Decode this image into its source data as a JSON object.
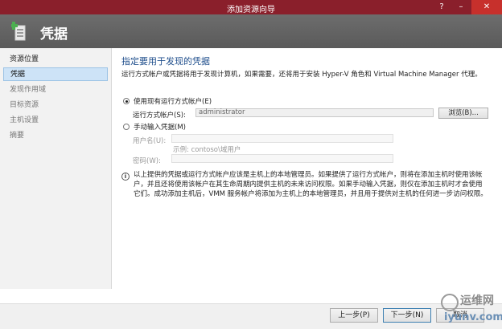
{
  "window": {
    "title": "添加资源向导",
    "help_label": "?",
    "minimize_label": "–",
    "close_label": "✕"
  },
  "header": {
    "icon": "host-add-icon",
    "title": "凭据"
  },
  "nav": {
    "items": [
      {
        "label": "资源位置",
        "state": "done"
      },
      {
        "label": "凭据",
        "state": "active"
      },
      {
        "label": "发现作用域",
        "state": "pending"
      },
      {
        "label": "目标资源",
        "state": "pending"
      },
      {
        "label": "主机设置",
        "state": "pending"
      },
      {
        "label": "摘要",
        "state": "pending"
      }
    ]
  },
  "main": {
    "title": "指定要用于发现的凭据",
    "description": "运行方式帐户或凭据将用于发现计算机，如果需要，还将用于安装 Hyper-V 角色和 Virtual Machine Manager 代理。",
    "use_runas": {
      "label": "使用现有运行方式帐户(E)",
      "checked": true
    },
    "runas_label": "运行方式帐户(S):",
    "runas_value": "administrator",
    "browse_label": "浏览(B)...",
    "manual": {
      "label": "手动输入凭据(M)",
      "checked": false
    },
    "username_label": "用户名(U):",
    "username_value": "",
    "username_example": "示例: contoso\\域用户",
    "password_label": "密码(W):",
    "password_value": "",
    "info_text": "以上提供的凭据或运行方式帐户应该是主机上的本地管理员。如果提供了运行方式帐户，则将在添加主机时使用该帐户，并且还将使用该帐户在其生命周期内提供主机的未来访问权限。如果手动输入凭据，则仅在添加主机时才会使用它们。成功添加主机后，VMM 服务帐户将添加为主机上的本地管理员，并且用于提供对主机的任何进一步访问权限。"
  },
  "footer": {
    "prev_label": "上一步(P)",
    "next_label": "下一步(N)",
    "cancel_label": "取消"
  },
  "watermark": {
    "line1": "运维网",
    "line2": "iyunv.com"
  },
  "colors": {
    "titlebar": "#8a1f2b",
    "header": "#616161",
    "accent": "#1f4e8c",
    "nav_active": "#cde3f7"
  }
}
